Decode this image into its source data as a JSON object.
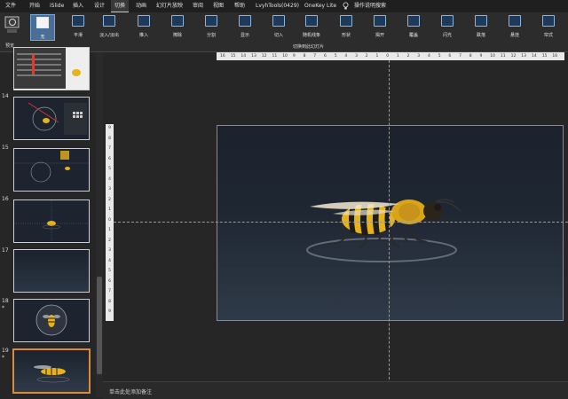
{
  "menu": {
    "file": "文件",
    "home": "开始",
    "islide": "iSlide",
    "insert": "插入",
    "design": "设计",
    "transitions": "切换",
    "animations": "动画",
    "slideshow": "幻灯片放映",
    "review": "审阅",
    "view": "视图",
    "help": "帮助",
    "lvyh": "LvyhTools(0429)",
    "onekey": "OneKey Lite",
    "search": "操作说明搜索"
  },
  "ribbon": {
    "preview_label": "预览",
    "group_label": "切换到此幻灯片",
    "transitions": [
      "无",
      "平滑",
      "淡入/淡出",
      "推入",
      "擦除",
      "分割",
      "显示",
      "切入",
      "随机线条",
      "形状",
      "揭开",
      "覆盖",
      "闪光",
      "跌落",
      "悬挂",
      "帘式"
    ]
  },
  "thumbnails": [
    {
      "num": ""
    },
    {
      "num": "14"
    },
    {
      "num": "15"
    },
    {
      "num": "16"
    },
    {
      "num": "17"
    },
    {
      "num": "18",
      "star": "*"
    },
    {
      "num": "19",
      "star": "*"
    }
  ],
  "ruler": {
    "h": [
      "16",
      "15",
      "14",
      "13",
      "12",
      "11",
      "10",
      "9",
      "8",
      "7",
      "6",
      "5",
      "4",
      "3",
      "2",
      "1",
      "0",
      "1",
      "2",
      "3",
      "4",
      "5",
      "6",
      "7",
      "8",
      "9",
      "10",
      "11",
      "12",
      "13",
      "14",
      "15",
      "16"
    ],
    "v": [
      "9",
      "8",
      "7",
      "6",
      "5",
      "4",
      "3",
      "2",
      "1",
      "0",
      "1",
      "2",
      "3",
      "4",
      "5",
      "6",
      "7",
      "8",
      "9"
    ]
  },
  "notes": {
    "placeholder": "单击此处添加备注"
  },
  "colors": {
    "accent_selected": "#d98a3a",
    "ribbon_active": "#4a6f96",
    "bee_yellow": "#e8b21a"
  }
}
